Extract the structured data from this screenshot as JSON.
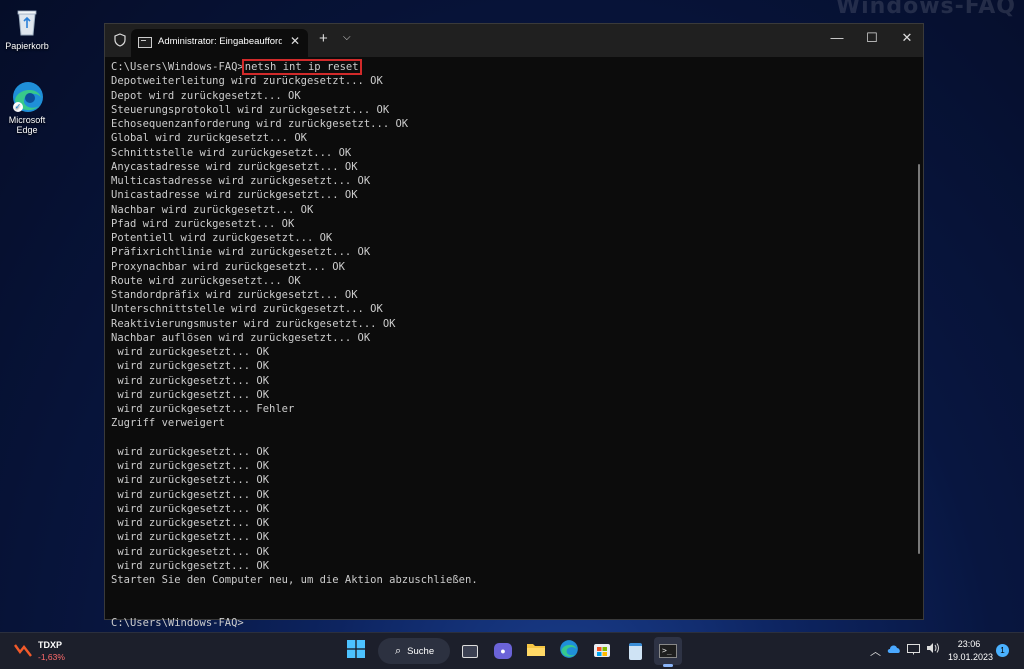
{
  "watermark": "Windows-FAQ",
  "desktop": {
    "recycle_bin": "Papierkorb",
    "edge_line1": "Microsoft",
    "edge_line2": "Edge"
  },
  "window": {
    "tab_title": "Administrator: Eingabeaufforderung",
    "tab_close": "✕",
    "new_tab": "+",
    "dropdown": "⌵",
    "minimize": "—",
    "maximize": "☐",
    "close": "✕"
  },
  "terminal": {
    "prompt": "C:\\Users\\Windows-FAQ>",
    "command": "netsh int ip reset",
    "output": [
      "Depotweiterleitung wird zurückgesetzt... OK",
      "Depot wird zurückgesetzt... OK",
      "Steuerungsprotokoll wird zurückgesetzt... OK",
      "Echosequenzanforderung wird zurückgesetzt... OK",
      "Global wird zurückgesetzt... OK",
      "Schnittstelle wird zurückgesetzt... OK",
      "Anycastadresse wird zurückgesetzt... OK",
      "Multicastadresse wird zurückgesetzt... OK",
      "Unicastadresse wird zurückgesetzt... OK",
      "Nachbar wird zurückgesetzt... OK",
      "Pfad wird zurückgesetzt... OK",
      "Potentiell wird zurückgesetzt... OK",
      "Präfixrichtlinie wird zurückgesetzt... OK",
      "Proxynachbar wird zurückgesetzt... OK",
      "Route wird zurückgesetzt... OK",
      "Standordpräfix wird zurückgesetzt... OK",
      "Unterschnittstelle wird zurückgesetzt... OK",
      "Reaktivierungsmuster wird zurückgesetzt... OK",
      "Nachbar auflösen wird zurückgesetzt... OK",
      " wird zurückgesetzt... OK",
      " wird zurückgesetzt... OK",
      " wird zurückgesetzt... OK",
      " wird zurückgesetzt... OK",
      " wird zurückgesetzt... Fehler",
      "Zugriff verweigert",
      "",
      " wird zurückgesetzt... OK",
      " wird zurückgesetzt... OK",
      " wird zurückgesetzt... OK",
      " wird zurückgesetzt... OK",
      " wird zurückgesetzt... OK",
      " wird zurückgesetzt... OK",
      " wird zurückgesetzt... OK",
      " wird zurückgesetzt... OK",
      " wird zurückgesetzt... OK",
      "Starten Sie den Computer neu, um die Aktion abzuschließen.",
      "",
      ""
    ],
    "final_prompt": "C:\\Users\\Windows-FAQ>",
    "highlight_color": "#d12a2a"
  },
  "taskbar": {
    "ticker_name": "TDXP",
    "ticker_change": "-1,63%",
    "search_label": "Suche",
    "time": "23:06",
    "date": "19.01.2023",
    "notification_count": "1",
    "tray_chevron": "︿"
  }
}
